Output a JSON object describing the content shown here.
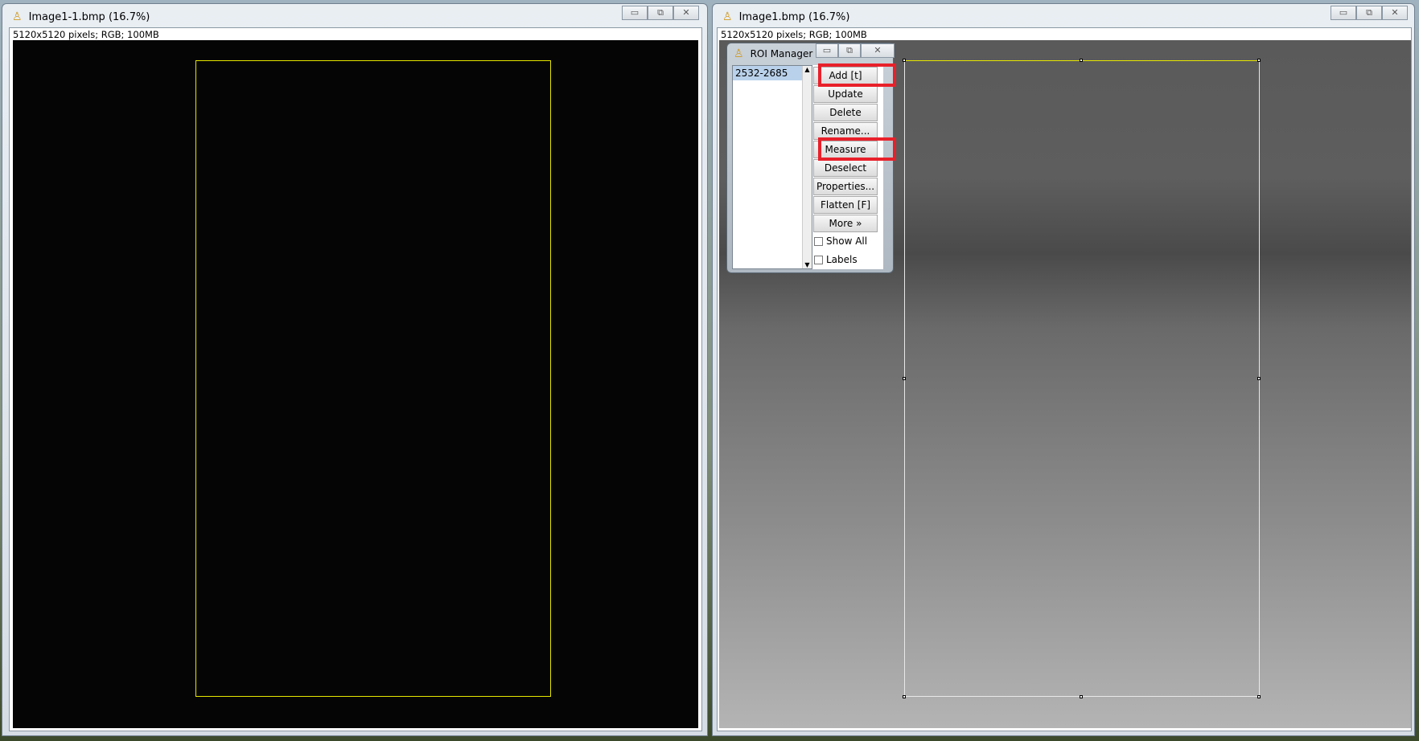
{
  "left_window": {
    "title": "Image1-1.bmp (16.7%)",
    "info": "5120x5120 pixels; RGB; 100MB"
  },
  "right_window": {
    "title": "Image1.bmp (16.7%)",
    "info": "5120x5120 pixels; RGB; 100MB"
  },
  "window_controls": {
    "minimize": "▭",
    "maximize": "⧉",
    "close": "✕"
  },
  "roi_manager": {
    "title": "ROI Manager",
    "list_items": [
      "2532-2685"
    ],
    "buttons": [
      "Add [t]",
      "Update",
      "Delete",
      "Rename...",
      "Measure",
      "Deselect",
      "Properties...",
      "Flatten [F]",
      "More »"
    ],
    "checkboxes": [
      {
        "label": "Show All",
        "checked": false
      },
      {
        "label": "Labels",
        "checked": false
      }
    ],
    "highlighted_buttons": [
      "Add [t]",
      "Measure"
    ]
  },
  "colors": {
    "roi_yellow": "#e6e600",
    "highlight_red": "#e8202a"
  }
}
